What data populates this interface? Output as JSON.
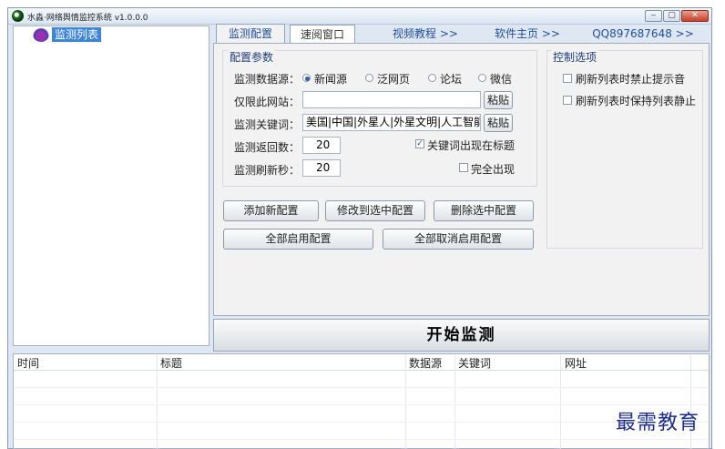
{
  "window": {
    "title": "水淼·网络舆情监控系统 v1.0.0.0",
    "controls": {
      "minimize": "‒",
      "maximize": "▢",
      "close": "✕"
    }
  },
  "tree": {
    "items": [
      {
        "label": "监测列表"
      }
    ]
  },
  "tabs": [
    {
      "label": "监测配置"
    },
    {
      "label": "速阅窗口"
    },
    {
      "label": "视频教程 >>"
    },
    {
      "label": "软件主页 >>"
    },
    {
      "label": "QQ897687648 >>"
    }
  ],
  "config": {
    "legend": "配置参数",
    "source_label": "监测数据源：",
    "sources": [
      {
        "label": "新闻源",
        "selected": true
      },
      {
        "label": "泛网页",
        "selected": false
      },
      {
        "label": "论坛",
        "selected": false
      },
      {
        "label": "微信",
        "selected": false
      }
    ],
    "site_label": "仅限此网站：",
    "site_value": "",
    "paste_label": "粘贴",
    "keywords_label": "监测关键词：",
    "keywords_value": "美国|中国|外星人|外星文明|人工智能",
    "return_label": "监测返回数：",
    "return_value": "20",
    "refresh_label": "监测刷新秒：",
    "refresh_value": "20",
    "title_check_label": "关键词出现在标题",
    "title_check": true,
    "exact_label": "完全出现",
    "exact_check": false
  },
  "buttons": {
    "add": "添加新配置",
    "modify": "修改到选中配置",
    "delete": "删除选中配置",
    "enable_all": "全部启用配置",
    "disable_all": "全部取消启用配置",
    "start": "开始监测"
  },
  "control": {
    "legend": "控制选项",
    "opt1": "刷新列表时禁止提示音",
    "opt2": "刷新列表时保持列表静止"
  },
  "table": {
    "columns": [
      "时间",
      "标题",
      "数据源",
      "关键词",
      "网址"
    ]
  },
  "watermark": "最需教育"
}
